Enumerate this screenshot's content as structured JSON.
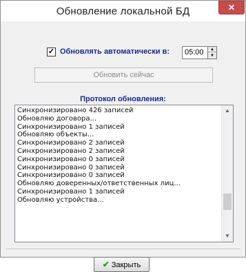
{
  "window": {
    "title": "Обновление локальной БД",
    "close_glyph": "✕"
  },
  "auto_update": {
    "checked": true,
    "check_glyph": "✓",
    "label": "Обновлять автоматически в:",
    "time_value": "05:00"
  },
  "update_now_button": {
    "label": "Обновить сейчас"
  },
  "log": {
    "title": "Протокол обновления:",
    "lines": [
      "Синхронизировано 426 записей",
      "Обновляю договора...",
      "Синхронизировано 1 записей",
      "Обновляю объекты...",
      "Синхронизировано 2 записей",
      "Синхронизировано 2 записей",
      "Синхронизировано 0 записей",
      "Синхронизировано 0 записей",
      "Синхронизировано 0 записей",
      "Обновляю доверенных/ответственных лиц...",
      "Синхронизировано 1 записей",
      "Обновляю устройства..."
    ]
  },
  "close_button": {
    "label": "Закрыть",
    "icon": "check-icon"
  },
  "colors": {
    "label_blue": "#1a2a8c",
    "close_red": "#c74c4c",
    "check_green": "#2c9a2c"
  }
}
